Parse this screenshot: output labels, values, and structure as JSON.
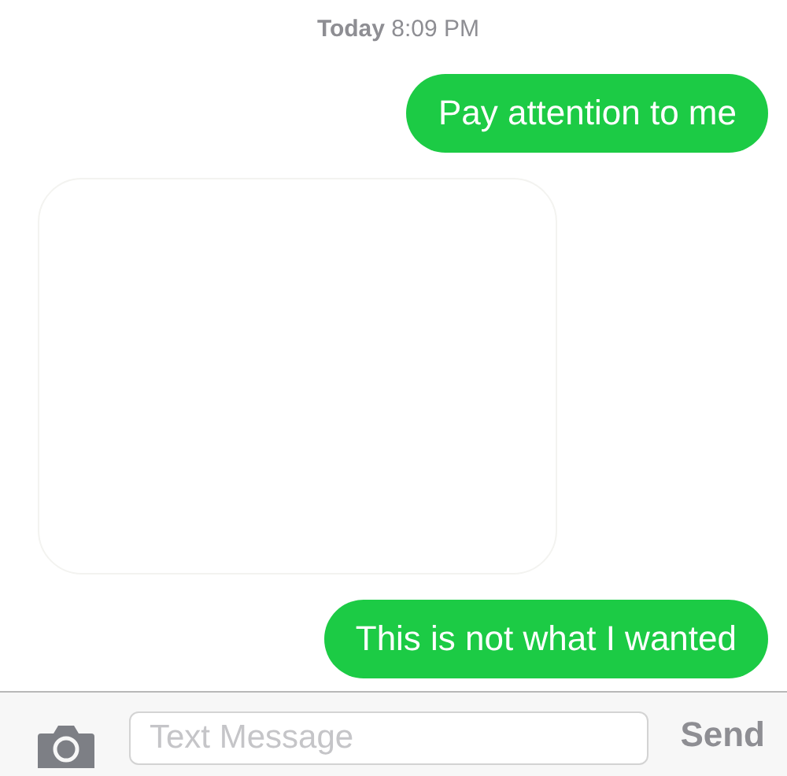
{
  "timestamp": {
    "day": "Today",
    "time": "8:09 PM"
  },
  "messages": [
    {
      "kind": "text",
      "outgoing": true,
      "text": "Pay attention to me"
    },
    {
      "kind": "image"
    },
    {
      "kind": "text",
      "outgoing": true,
      "text": "This is not what I wanted"
    }
  ],
  "composer": {
    "placeholder": "Text Message",
    "send": {
      "label": "Send",
      "disabled": true
    }
  }
}
